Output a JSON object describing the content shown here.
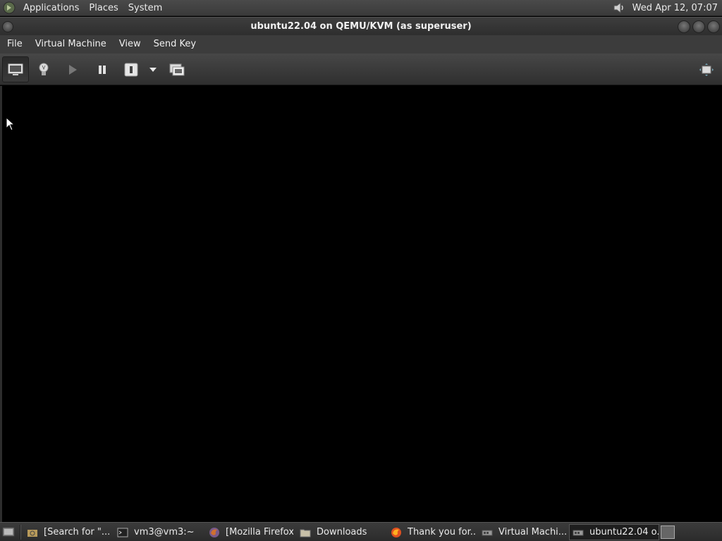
{
  "top_panel": {
    "menus": [
      "Applications",
      "Places",
      "System"
    ],
    "clock": "Wed Apr 12, 07:07"
  },
  "window": {
    "title": "ubuntu22.04 on QEMU/KVM (as superuser)"
  },
  "menubar": {
    "items": [
      "File",
      "Virtual Machine",
      "View",
      "Send Key"
    ]
  },
  "toolbar": {
    "buttons": [
      {
        "icon": "monitor-icon"
      },
      {
        "icon": "lightbulb-icon"
      },
      {
        "icon": "play-icon"
      },
      {
        "icon": "pause-icon"
      },
      {
        "icon": "power-icon"
      },
      {
        "icon": "dropdown-arrow-icon"
      },
      {
        "icon": "snapshots-icon"
      },
      {
        "icon": "fullscreen-icon"
      }
    ]
  },
  "taskbar": {
    "tasks": [
      {
        "label": "[Search for \"...",
        "icon": "search-folder-icon"
      },
      {
        "label": "vm3@vm3:~",
        "icon": "terminal-icon"
      },
      {
        "label": "[Mozilla Firefox]",
        "icon": "firefox-icon"
      },
      {
        "label": "Downloads",
        "icon": "folder-icon"
      },
      {
        "label": "Thank you for...",
        "icon": "firefox-icon"
      },
      {
        "label": "Virtual Machi...",
        "icon": "virt-manager-icon"
      },
      {
        "label": "ubuntu22.04 o...",
        "icon": "virt-manager-icon"
      }
    ]
  }
}
